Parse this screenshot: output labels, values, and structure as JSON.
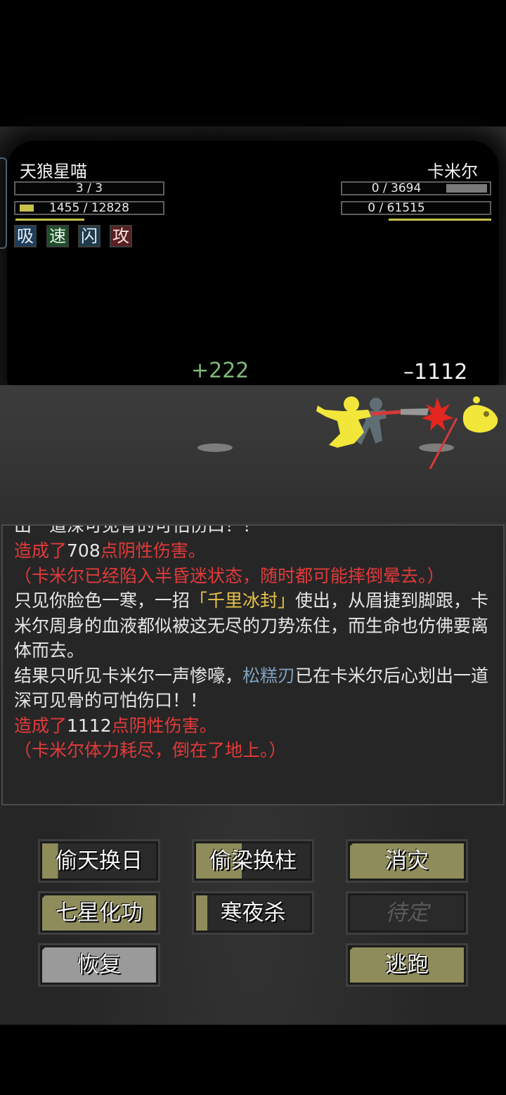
{
  "player": {
    "name": "天狼星喵",
    "qi": "3 / 3",
    "hp": "1455 / 12828",
    "hp_fraction": 0.113,
    "buffs": [
      "吸",
      "速",
      "闪",
      "攻"
    ]
  },
  "enemy": {
    "name": "卡米尔",
    "qi": "0 / 3694",
    "hp": "0 / 61515"
  },
  "floating": {
    "heal": "+222",
    "damage": "–1112"
  },
  "log": {
    "cut_line": "出一道深可见骨的可怕伤口！！",
    "line1_prefix": "造成了",
    "line1_num": "708",
    "line1_suffix": "点阴性伤害。",
    "line2": "（卡米尔已经陷入半昏迷状态，随时都可能摔倒晕去。）",
    "line3_a": "只见你脸色一寒，一招",
    "line3_skill": "「千里冰封」",
    "line3_b": "使出，从眉捷到脚跟，卡米尔周身的血液都似被这无尽的刀势冻住，而生命也仿佛要离体而去。",
    "line4_a": "结果只听见卡米尔一声惨嚎，",
    "line4_weapon": "松糕刃",
    "line4_b": "已在卡米尔后心划出一道深可见骨的可怕伤口！！",
    "line5_prefix": "造成了",
    "line5_num": "1112",
    "line5_suffix": "点阴性伤害。",
    "line6": "（卡米尔体力耗尽，倒在了地上。）"
  },
  "buttons": {
    "b1": "偷天换日",
    "b2": "偷梁换柱",
    "b3": "消灾",
    "b4": "七星化功",
    "b5": "寒夜杀",
    "b6": "待定",
    "b7": "恢复",
    "b8": "逃跑"
  }
}
